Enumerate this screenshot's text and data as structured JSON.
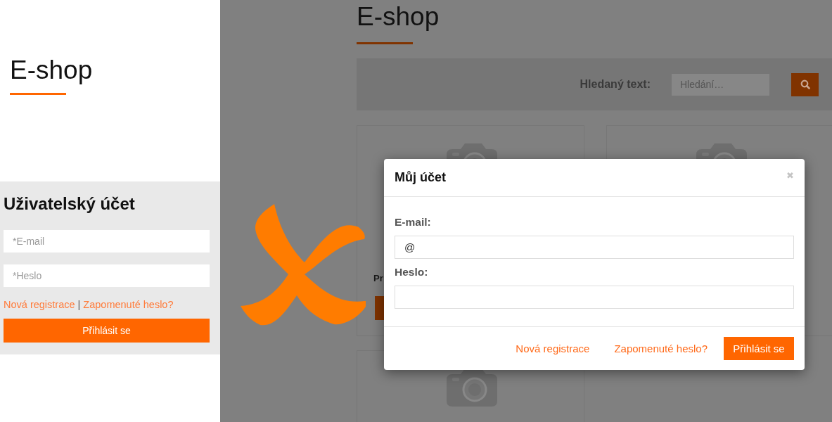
{
  "left_panel": {
    "title": "E-shop",
    "account_box": {
      "title": "Uživatelský účet",
      "fields": [
        {
          "placeholder": "*E-mail"
        },
        {
          "placeholder": "*Heslo"
        }
      ],
      "links": [
        "Nová registrace",
        "Zapomenuté heslo?"
      ],
      "separator": "|",
      "button": "Přihlásit se"
    }
  },
  "background_page": {
    "title": "E-shop",
    "search": {
      "label": "Hledaný text:",
      "placeholder": "Hledání…"
    },
    "cards": [
      {
        "kind": "product",
        "text": "Pr"
      },
      {
        "kind": "image_only"
      },
      {
        "kind": "image_only"
      }
    ]
  },
  "modal": {
    "title": "Můj účet",
    "close": "✖",
    "fields": [
      {
        "label": "E-mail:",
        "value": "@"
      },
      {
        "label": "Heslo:"
      }
    ],
    "links": [
      "Nová registrace",
      "Zapomenuté heslo?"
    ],
    "button": "Přihlásit se"
  }
}
